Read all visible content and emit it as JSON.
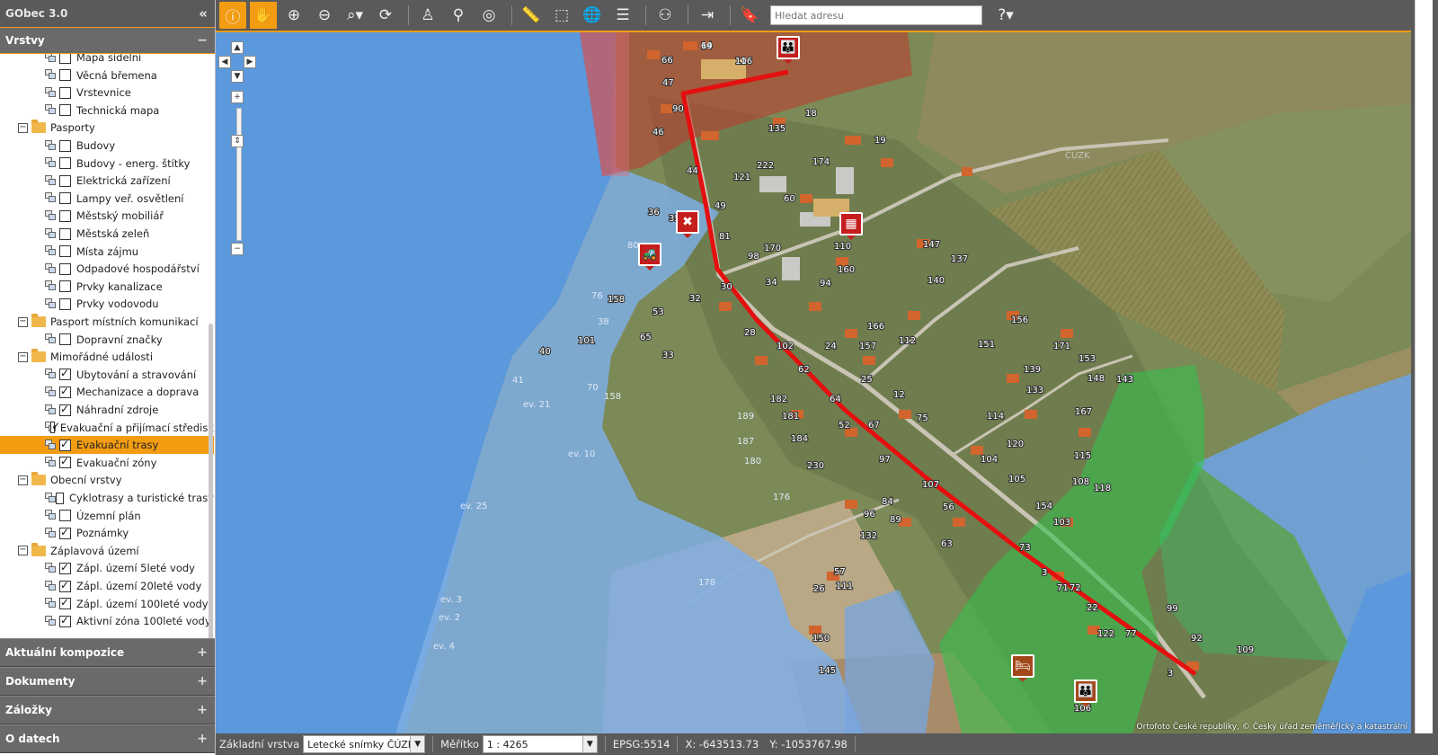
{
  "app": {
    "title": "GObec 3.0"
  },
  "sidebar": {
    "layers_panel": "Vrstvy",
    "tree": [
      {
        "type": "layer",
        "label": "Mapa sídelní",
        "checked": false
      },
      {
        "type": "layer",
        "label": "Věcná břemena",
        "checked": false
      },
      {
        "type": "layer",
        "label": "Vrstevnice",
        "checked": false
      },
      {
        "type": "layer",
        "label": "Technická mapa",
        "checked": false
      },
      {
        "type": "group",
        "label": "Pasporty"
      },
      {
        "type": "layer",
        "label": "Budovy",
        "checked": false
      },
      {
        "type": "layer",
        "label": "Budovy - energ. štítky",
        "checked": false
      },
      {
        "type": "layer",
        "label": "Elektrická zařízení",
        "checked": false
      },
      {
        "type": "layer",
        "label": "Lampy veř. osvětlení",
        "checked": false
      },
      {
        "type": "layer",
        "label": "Městský mobiliář",
        "checked": false
      },
      {
        "type": "layer",
        "label": "Městská zeleň",
        "checked": false
      },
      {
        "type": "layer",
        "label": "Místa zájmu",
        "checked": false
      },
      {
        "type": "layer",
        "label": "Odpadové hospodářství",
        "checked": false
      },
      {
        "type": "layer",
        "label": "Prvky kanalizace",
        "checked": false
      },
      {
        "type": "layer",
        "label": "Prvky vodovodu",
        "checked": false
      },
      {
        "type": "group",
        "label": "Pasport místních komunikací"
      },
      {
        "type": "layer",
        "label": "Dopravní značky",
        "checked": false
      },
      {
        "type": "group",
        "label": "Mimořádné události"
      },
      {
        "type": "layer",
        "label": "Ubytování a stravování",
        "checked": true
      },
      {
        "type": "layer",
        "label": "Mechanizace a doprava",
        "checked": true
      },
      {
        "type": "layer",
        "label": "Náhradní zdroje",
        "checked": true
      },
      {
        "type": "layer",
        "label": "Evakuační a přijímací středisk",
        "checked": true
      },
      {
        "type": "layer",
        "label": "Evakuační trasy",
        "checked": true,
        "selected": true
      },
      {
        "type": "layer",
        "label": "Evakuační zóny",
        "checked": true
      },
      {
        "type": "group",
        "label": "Obecní vrstvy"
      },
      {
        "type": "layer",
        "label": "Cyklotrasy a turistické trasy",
        "checked": false
      },
      {
        "type": "layer",
        "label": "Územní plán",
        "checked": false
      },
      {
        "type": "layer",
        "label": "Poznámky",
        "checked": true
      },
      {
        "type": "group",
        "label": "Záplavová území"
      },
      {
        "type": "layer",
        "label": "Zápl. území 5leté vody",
        "checked": true
      },
      {
        "type": "layer",
        "label": "Zápl. území 20leté vody",
        "checked": true
      },
      {
        "type": "layer",
        "label": "Zápl. území 100leté vody",
        "checked": true
      },
      {
        "type": "layer",
        "label": "Aktivní zóna 100leté vody",
        "checked": true
      }
    ],
    "panels": [
      "Aktuální kompozice",
      "Dokumenty",
      "Záložky",
      "O datech"
    ]
  },
  "toolbar": {
    "search_placeholder": "Hledat adresu",
    "help_icon": "help-icon"
  },
  "map": {
    "attribution": "Ortofoto České republiky, © Český úřad zeměměřický a katastrální",
    "house_numbers": [
      "14",
      "116",
      "66",
      "47",
      "90",
      "46",
      "18",
      "135",
      "19",
      "222",
      "174",
      "44",
      "121",
      "49",
      "60",
      "36",
      "35",
      "81",
      "110",
      "170",
      "147",
      "98",
      "137",
      "160",
      "30",
      "34",
      "94",
      "140",
      "32",
      "158",
      "53",
      "65",
      "166",
      "156",
      "28",
      "102",
      "24",
      "157",
      "112",
      "151",
      "171",
      "153",
      "33",
      "40",
      "101",
      "62",
      "25",
      "139",
      "148",
      "143",
      "182",
      "64",
      "12",
      "133",
      "181",
      "52",
      "67",
      "75",
      "114",
      "167",
      "184",
      "120",
      "115",
      "97",
      "230",
      "104",
      "105",
      "107",
      "108",
      "118",
      "84",
      "154",
      "96",
      "89",
      "56",
      "103",
      "132",
      "63",
      "73",
      "57",
      "111",
      "3",
      "71",
      "72",
      "22",
      "26",
      "99",
      "122",
      "77",
      "150",
      "92",
      "109",
      "145",
      "3",
      "106",
      "41",
      "70",
      "189",
      "187",
      "180",
      "176",
      "178",
      "80",
      "76",
      "38",
      "158",
      "69",
      "10"
    ],
    "flood_labels": [
      "ev. 21",
      "ev. 10",
      "ev. 25",
      "ev. 3",
      "ev. 2",
      "ev. 4"
    ],
    "zone_stamp": "ČÚZK"
  },
  "statusbar": {
    "base_layer_label": "Základní vrstva",
    "base_layer_value": "Letecké snímky ČÚZK",
    "scale_label": "Měřítko",
    "scale_value": "1 : 4265",
    "epsg": "EPSG:5514",
    "x": "X: -643513.73",
    "y": "Y: -1053767.98"
  },
  "colors": {
    "accent": "#f39c12",
    "toolbar": "#5a5a5a",
    "route": "#e41010",
    "flood": "#4f8fdc",
    "zone_red": "#c0392b",
    "zone_green": "#2ecc40"
  }
}
